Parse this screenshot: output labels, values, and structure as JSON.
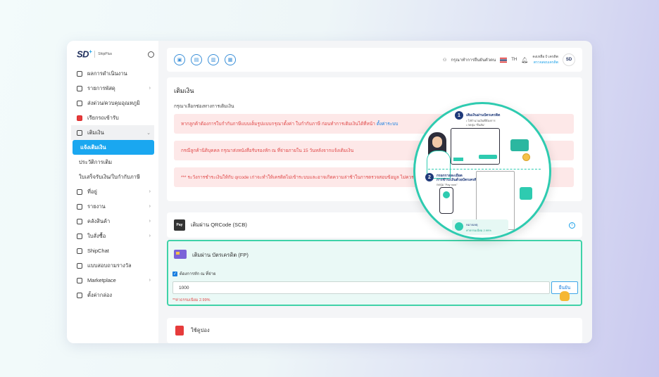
{
  "brand": {
    "logo": "SD",
    "logo_sup": "+",
    "product": "ShipPlus"
  },
  "sidebar": {
    "items": [
      {
        "label": "ผลการดำเนินงาน",
        "icon": "home-icon"
      },
      {
        "label": "รายการพัสดุ",
        "icon": "box-icon",
        "chevron": "›"
      },
      {
        "label": "ส่งด่วน/ควบคุมอุณหภูมิ",
        "icon": "thermo-icon"
      },
      {
        "label": "เรียกรถเข้ารับ",
        "icon": "truck-icon"
      },
      {
        "label": "เติมเงิน",
        "icon": "wallet-icon",
        "chevron": "⌄"
      }
    ],
    "sub_items": [
      {
        "label": "แจ้งเติมเงิน",
        "active": true
      },
      {
        "label": "ประวัติการเติม"
      },
      {
        "label": "ใบเสร็จรับเงิน/ใบกำกับภาษี"
      }
    ],
    "more_items": [
      {
        "label": "ที่อยู่",
        "icon": "map-icon",
        "chevron": "›"
      },
      {
        "label": "รายงาน",
        "icon": "folder-icon",
        "chevron": "›"
      },
      {
        "label": "คลังสินค้า",
        "icon": "warehouse-icon",
        "chevron": "›"
      },
      {
        "label": "ใบสั่งซื้อ",
        "icon": "document-icon",
        "chevron": "›"
      },
      {
        "label": "ShipChat",
        "icon": "chat-icon"
      },
      {
        "label": "แบบสอบถามรางวัล",
        "icon": "survey-icon"
      },
      {
        "label": "Marketplace",
        "icon": "cart-icon",
        "chevron": "›"
      },
      {
        "label": "ตั้งค่ากล่อง",
        "icon": "box-settings-icon"
      }
    ]
  },
  "topbar": {
    "verify_text": "กรุณาทำการยืนยันตัวตน",
    "language": "TH",
    "credit_label": "คงเหลือ",
    "credit_value": "0",
    "credit_unit": "เครดิต",
    "credit_link": "ตรวจสอบเครดิต",
    "avatar_text": "SD"
  },
  "topup": {
    "title": "เติมเงิน",
    "hint": "กรุณาเลือกช่องทางการเติมเงิน",
    "notice_1": "หากลูกค้าต้องการใบกำกับภาษีแบบเต็มรูปแบบกรุณาตั้งค่า ใบกำกับภาษี ก่อนทำการเติมเงินได้ที่หน้า",
    "notice_1_link": "ตั้งค่าระบบ",
    "notice_2": "กรณีลูกค้านิติบุคคล กรุณาส่งหนังสือรับรองหัก ณ ที่จ่ายภายใน 15 วันหลังจากแจ้งเติมเงิน",
    "notice_3": "*** ระวังการชำระเงินให้กับ qrcode เก่าจะทำให้เครดิตไม่เข้าระบบและอาจเกิดความล่าช้าในการตรวจสอบข้อมูล ไม่ควร"
  },
  "qr_method": {
    "logo_text": "Pay",
    "label": "เติมผ่าน QRCode (SCB)",
    "info": "i"
  },
  "card_method": {
    "label": "เติมผ่าน บัตรเครดิต (FP)",
    "withholding_checkbox": "ต้องการหัก ณ ที่จ่าย",
    "checked_mark": "✓",
    "amount": "1000",
    "submit_label": "ยืนยัน",
    "fee_note": "**ค่าธรรมเนียม 2.99%"
  },
  "coupon": {
    "label": "ใช้คูปอง"
  },
  "illustration": {
    "step1_num": "1",
    "step1_title": "เติมเงินผ่านบัตรเครดิต",
    "step1_sub1": "• ใส่จำนวนเงินที่ต้องการ",
    "step1_sub2": "• กดปุ่ม \"ยืนยัน\"",
    "step2_num": "2",
    "step2_title": "กรอกรายละเอียด",
    "step2_title2": "การชำระเงินด้วยบัตรเครดิต",
    "step2_sub": "กดปุ่ม \"Pay now\"",
    "promo_title": "หมายเหตุ",
    "promo_text": "ค่าธรรมเนียม 2.99%"
  },
  "colors": {
    "accent": "#1aa7f0",
    "teal": "#2ecbb0",
    "alert_bg": "#fde8e8",
    "alert_text": "#e04848"
  }
}
